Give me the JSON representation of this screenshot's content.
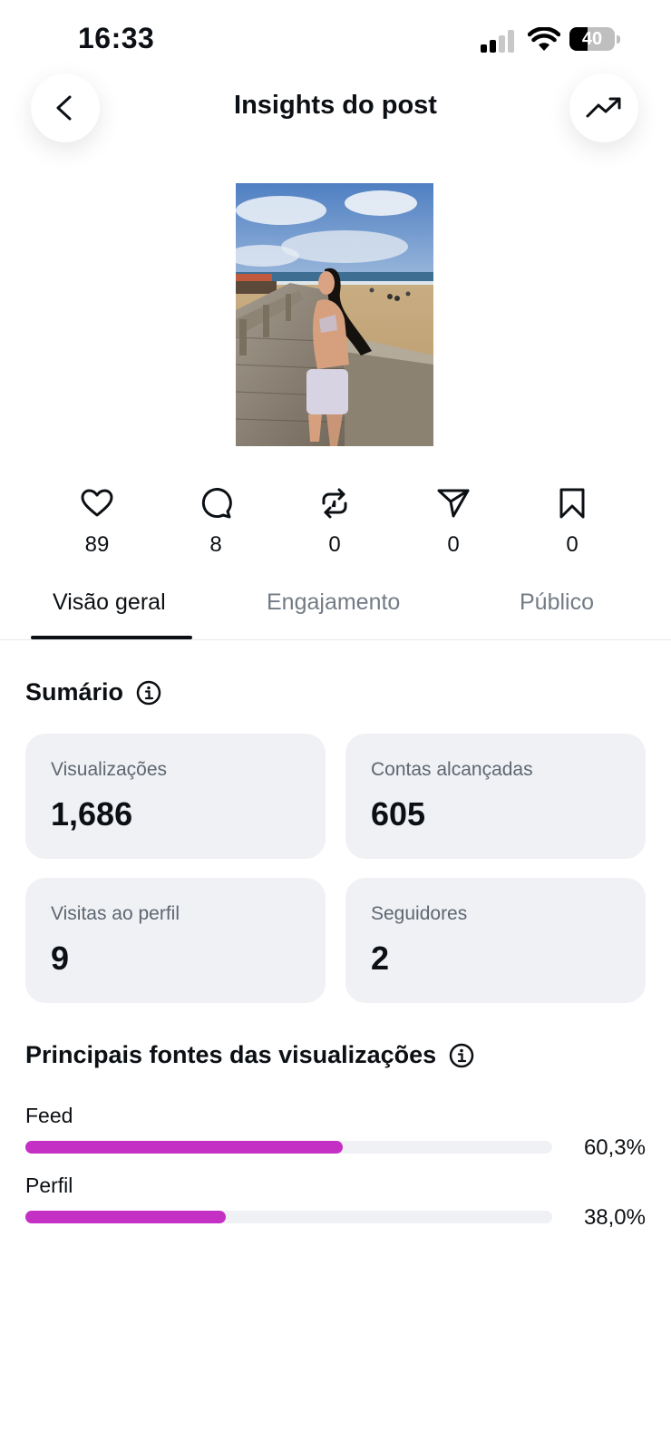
{
  "status_bar": {
    "time": "16:33",
    "battery": "40",
    "battery_level": 0.4
  },
  "header": {
    "title": "Insights do post",
    "back_icon": "chevron-left-icon",
    "trend_icon": "trending-up-icon"
  },
  "post": {
    "image_alt": "Foto do post"
  },
  "metrics": [
    {
      "icon": "heart-icon",
      "value": "89"
    },
    {
      "icon": "comment-icon",
      "value": "8"
    },
    {
      "icon": "repost-icon",
      "value": "0"
    },
    {
      "icon": "share-icon",
      "value": "0"
    },
    {
      "icon": "bookmark-icon",
      "value": "0"
    }
  ],
  "tabs": [
    {
      "label": "Visão geral",
      "active": true
    },
    {
      "label": "Engajamento",
      "active": false
    },
    {
      "label": "Público",
      "active": false
    }
  ],
  "summary": {
    "title": "Sumário",
    "cards": [
      {
        "label": "Visualizações",
        "value": "1,686"
      },
      {
        "label": "Contas alcançadas",
        "value": "605"
      },
      {
        "label": "Visitas ao perfil",
        "value": "9"
      },
      {
        "label": "Seguidores",
        "value": "2"
      }
    ]
  },
  "sources": {
    "title": "Principais fontes das visualizações",
    "accent": "#c42fc4",
    "items": [
      {
        "label": "Feed",
        "percent_text": "60,3%",
        "percent": 60.3
      },
      {
        "label": "Perfil",
        "percent_text": "38,0%",
        "percent": 38.0
      }
    ]
  }
}
